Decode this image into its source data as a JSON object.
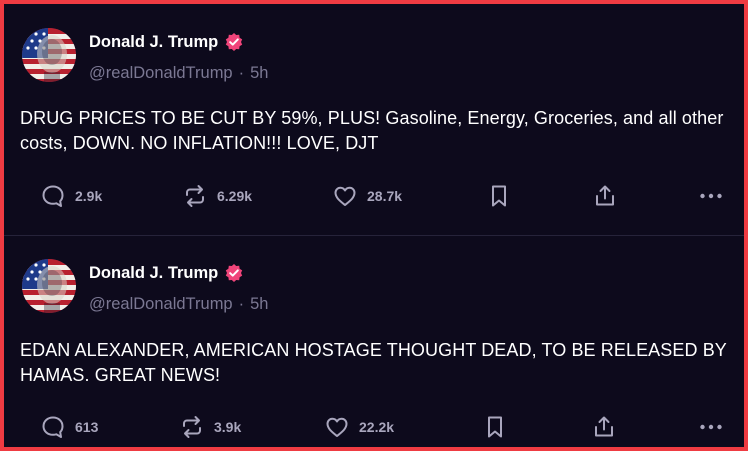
{
  "colors": {
    "background": "#0d0a1c",
    "border": "#ef3b42",
    "verified_badge": "#f0447a",
    "muted_text": "#7b7893",
    "icon": "#a9a6bd"
  },
  "posts": [
    {
      "author_name": "Donald J. Trump",
      "handle": "@realDonaldTrump",
      "separator": "·",
      "time": "5h",
      "text": "DRUG PRICES TO BE CUT BY 59%, PLUS! Gasoline, Energy, Groceries, and all other costs, DOWN. NO INFLATION!!! LOVE, DJT",
      "replies": "2.9k",
      "reposts": "6.29k",
      "likes": "28.7k",
      "icons": [
        "reply-icon",
        "repost-icon",
        "like-icon",
        "bookmark-icon",
        "share-icon",
        "more-icon"
      ]
    },
    {
      "author_name": "Donald J. Trump",
      "handle": "@realDonaldTrump",
      "separator": "·",
      "time": "5h",
      "text": "EDAN ALEXANDER, AMERICAN HOSTAGE THOUGHT DEAD, TO BE RELEASED BY HAMAS. GREAT NEWS!",
      "replies": "613",
      "reposts": "3.9k",
      "likes": "22.2k",
      "icons": [
        "reply-icon",
        "repost-icon",
        "like-icon",
        "bookmark-icon",
        "share-icon",
        "more-icon"
      ]
    }
  ]
}
